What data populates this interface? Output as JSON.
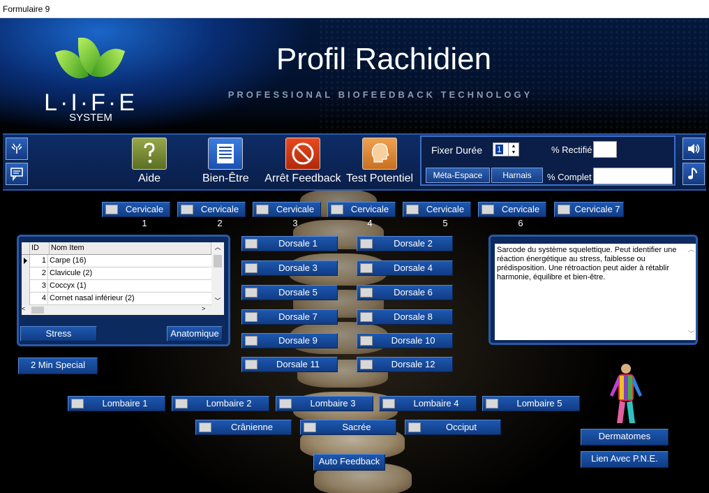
{
  "window": {
    "title": "Formulaire 9"
  },
  "header": {
    "logo_letters": "L·I·F·E",
    "logo_sub": "SYSTEM",
    "title": "Profil Rachidien",
    "tagline": "PROFESSIONAL BIOFEEDBACK TECHNOLOGY"
  },
  "toolbar": {
    "help": "Aide",
    "wellbeing": "Bien-Être",
    "stop": "Arrêt Feedback",
    "test": "Test Potentiel",
    "fix_duration_label": "Fixer Durée",
    "duration_value": "1",
    "rectified_label": "% Rectifié",
    "rectified_value": "",
    "meta_space": "Méta-Espace",
    "harness": "Harnais",
    "complete_label": "% Complet",
    "complete_value": ""
  },
  "cervicales": [
    "Cervicale 1",
    "Cervicale 2",
    "Cervicale 3",
    "Cervicale 4",
    "Cervicale 5",
    "Cervicale 6",
    "Cervicale 7"
  ],
  "dorsales": [
    "Dorsale 1",
    "Dorsale 2",
    "Dorsale 3",
    "Dorsale 4",
    "Dorsale 5",
    "Dorsale 6",
    "Dorsale 7",
    "Dorsale 8",
    "Dorsale 9",
    "Dorsale 10",
    "Dorsale 11",
    "Dorsale 12"
  ],
  "lombaires": [
    "Lombaire 1",
    "Lombaire 2",
    "Lombaire 3",
    "Lombaire 4",
    "Lombaire 5"
  ],
  "others": [
    "Crânienne",
    "Sacrée",
    "Occiput"
  ],
  "grid": {
    "headers": {
      "id": "ID",
      "name": "Nom Item"
    },
    "rows": [
      {
        "id": "1",
        "name": "Carpe (16)"
      },
      {
        "id": "2",
        "name": "Clavicule (2)"
      },
      {
        "id": "3",
        "name": "Coccyx (1)"
      },
      {
        "id": "4",
        "name": "Cornet nasal inférieur (2)"
      }
    ]
  },
  "buttons": {
    "stress": "Stress",
    "anatomical": "Anatomique",
    "two_min": "2 Min Special",
    "auto_feedback": "Auto Feedback",
    "dermatomes": "Dermatomes",
    "pne_link": "Lien Avec P.N.E."
  },
  "info_text": "Sarcode du système squelettique.  Peut identifier une réaction énergétique au stress, faiblesse ou prédisposition.  Une rétroaction peut aider à rétablir harmonie, équilibre et bien-être."
}
